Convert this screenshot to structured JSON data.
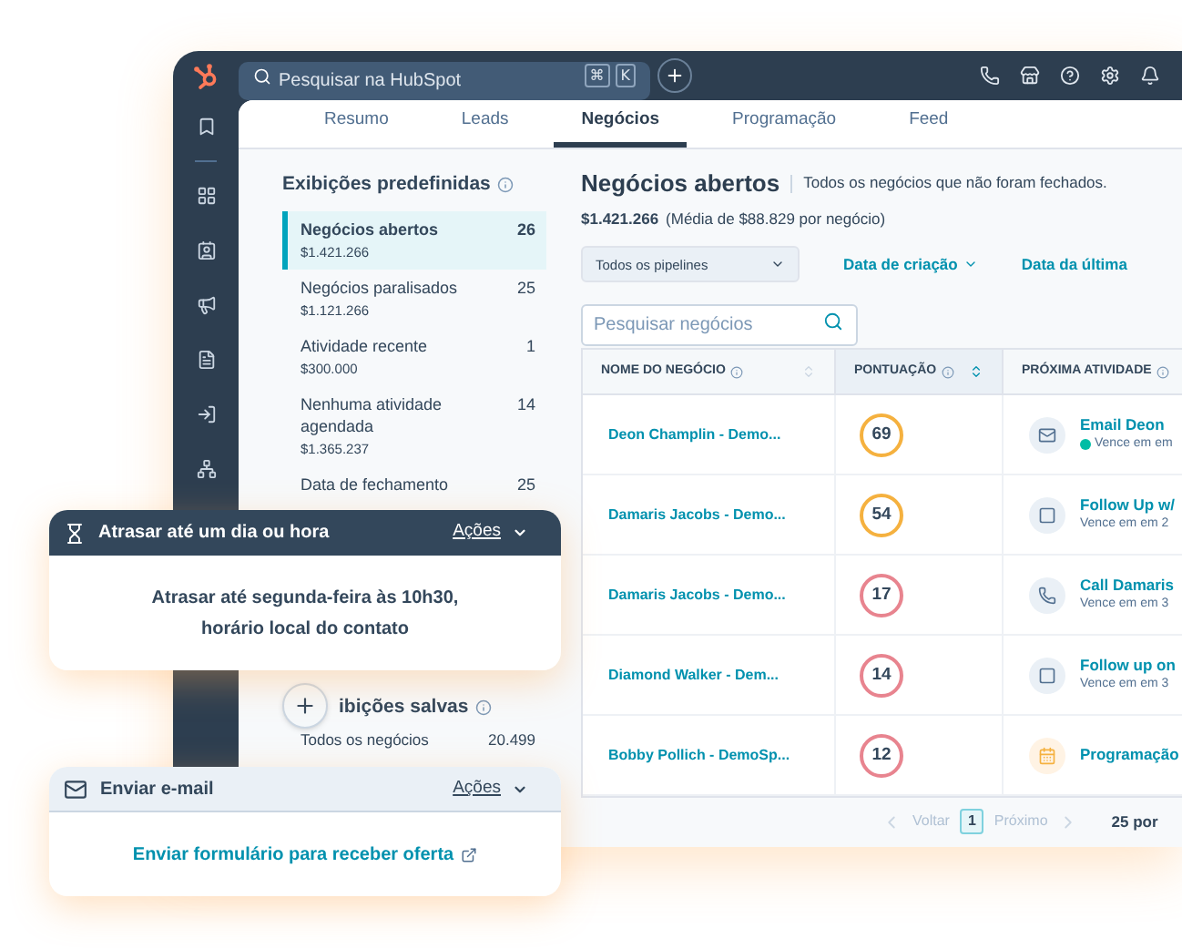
{
  "top_bar": {
    "search": {
      "placeholder": "Pesquisar na HubSpot"
    },
    "shortcut_keys": [
      "⌘",
      "K"
    ]
  },
  "tabs": [
    {
      "label": "Resumo",
      "selected": false
    },
    {
      "label": "Leads",
      "selected": false
    },
    {
      "label": "Negócios",
      "selected": true
    },
    {
      "label": "Programação",
      "selected": false
    },
    {
      "label": "Feed",
      "selected": false
    }
  ],
  "sidebar": {
    "title": "Exibições predefinidas",
    "items": [
      {
        "label": "Negócios abertos",
        "count": "26",
        "amount": "$1.421.266",
        "selected": true
      },
      {
        "label": "Negócios paralisados",
        "count": "25",
        "amount": "$1.121.266",
        "selected": false
      },
      {
        "label": "Atividade recente",
        "count": "1",
        "amount": "$300.000",
        "selected": false
      },
      {
        "label": "Nenhuma atividade agendada",
        "count": "14",
        "amount": "$1.365.237",
        "selected": false
      },
      {
        "label": "Data de fechamento",
        "count": "25",
        "selected": false
      }
    ],
    "saved_title": "ibições salvas",
    "saved_items": [
      {
        "label": "Todos os negócios",
        "count": "20.499"
      }
    ]
  },
  "main": {
    "title": "Negócios abertos",
    "description": "Todos os negócios que não foram fechados.",
    "total": "$1.421.266",
    "average": "(Média de $88.829 por negócio)",
    "filters": [
      {
        "label": "Todos os pipelines",
        "kind": "dropdown"
      },
      {
        "label": "Data de criação",
        "kind": "link",
        "caret": true
      },
      {
        "label": "Data da última",
        "kind": "link",
        "caret": false
      }
    ],
    "search": {
      "placeholder": "Pesquisar negócios"
    },
    "table": {
      "columns": [
        {
          "label": "NOME DO NEGÓCIO",
          "sorted": false
        },
        {
          "label": "PONTUAÇÃO",
          "sorted": true
        },
        {
          "label": "PRÓXIMA ATIVIDADE"
        }
      ],
      "rows": [
        {
          "name": "Deon Champlin - Demo...",
          "score": "69",
          "color": "#f5b13f",
          "activity": {
            "kind": "email",
            "title": "Email Deon",
            "due": "Vence em em",
            "color": "#00bda5"
          }
        },
        {
          "name": "Damaris Jacobs - Demo...",
          "score": "54",
          "color": "#f5b13f",
          "activity": {
            "kind": "task",
            "title": "Follow Up w/",
            "due": "Vence em em 2"
          }
        },
        {
          "name": "Damaris Jacobs - Demo...",
          "score": "17",
          "color": "#e8848f",
          "activity": {
            "kind": "call",
            "title": "Call Damaris",
            "due": "Vence em em 3"
          }
        },
        {
          "name": "Diamond Walker - Dem...",
          "score": "14",
          "color": "#e8848f",
          "activity": {
            "kind": "task",
            "title": "Follow up on",
            "due": "Vence em em 3"
          }
        },
        {
          "name": "Bobby Pollich - DemoSp...",
          "score": "12",
          "color": "#e8848f",
          "activity": {
            "kind": "meeting",
            "title": "Programação"
          }
        }
      ]
    },
    "pagination": {
      "previous": "Voltar",
      "page": "1",
      "next": "Próximo",
      "per_page": "25 por"
    }
  },
  "cards": [
    {
      "kind": "delay",
      "title": "Atrasar até um dia ou hora",
      "action": "Ações",
      "body_lines": [
        "Atrasar até segunda-feira às 10h30,",
        "horário local do contato"
      ]
    },
    {
      "kind": "email",
      "title": "Enviar e-mail",
      "action": "Ações",
      "link": "Enviar formulário para receber oferta"
    }
  ]
}
